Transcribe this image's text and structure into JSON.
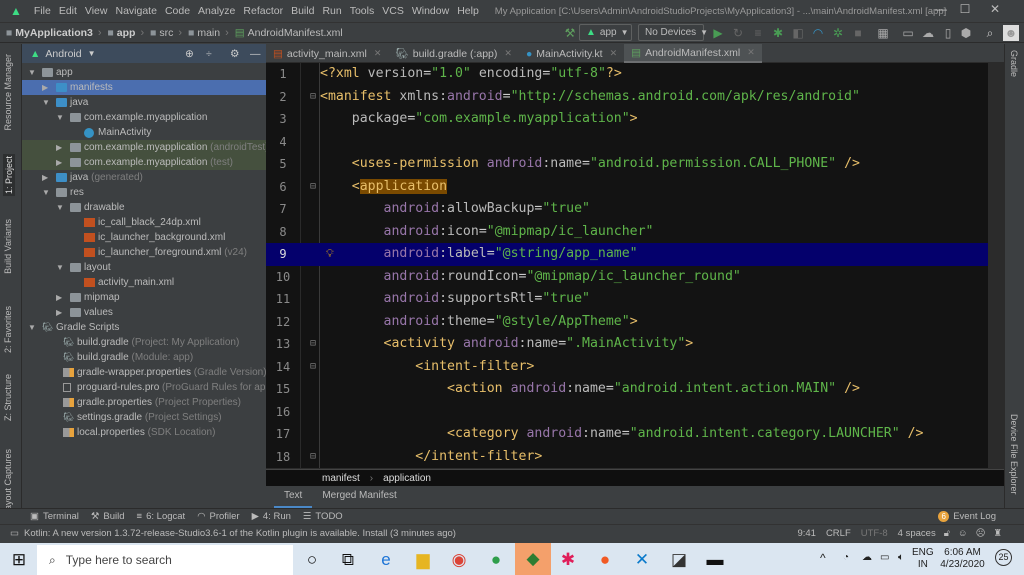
{
  "menu": [
    "File",
    "Edit",
    "View",
    "Navigate",
    "Code",
    "Analyze",
    "Refactor",
    "Build",
    "Run",
    "Tools",
    "VCS",
    "Window",
    "Help"
  ],
  "window_title": "My Application [C:\\Users\\Admin\\AndroidStudioProjects\\MyApplication3] - ...\\main\\AndroidManifest.xml [app]",
  "breadcrumb": [
    "MyApplication3",
    "app",
    "src",
    "main",
    "AndroidManifest.xml"
  ],
  "toolbar": {
    "run_config": "app",
    "device": "No Devices"
  },
  "project": {
    "view": "Android",
    "tree": [
      {
        "level": 0,
        "arrow": "down",
        "icon": "module",
        "label": "app",
        "hint": "",
        "state": ""
      },
      {
        "level": 1,
        "arrow": "right",
        "icon": "folder-blue",
        "label": "manifests",
        "hint": "",
        "state": "sel"
      },
      {
        "level": 1,
        "arrow": "down",
        "icon": "folder-blue",
        "label": "java",
        "hint": "",
        "state": ""
      },
      {
        "level": 2,
        "arrow": "down",
        "icon": "package",
        "label": "com.example.myapplication",
        "hint": "",
        "state": ""
      },
      {
        "level": 3,
        "arrow": "",
        "icon": "kotlin-class",
        "label": "MainActivity",
        "hint": "",
        "state": ""
      },
      {
        "level": 2,
        "arrow": "right",
        "icon": "package",
        "label": "com.example.myapplication",
        "hint": "(androidTest)",
        "state": "test"
      },
      {
        "level": 2,
        "arrow": "right",
        "icon": "package",
        "label": "com.example.myapplication",
        "hint": "(test)",
        "state": "test"
      },
      {
        "level": 1,
        "arrow": "right",
        "icon": "folder-blue",
        "label": "java",
        "hint": "(generated)",
        "state": ""
      },
      {
        "level": 1,
        "arrow": "down",
        "icon": "folder",
        "label": "res",
        "hint": "",
        "state": ""
      },
      {
        "level": 2,
        "arrow": "down",
        "icon": "package",
        "label": "drawable",
        "hint": "",
        "state": ""
      },
      {
        "level": 3,
        "arrow": "",
        "icon": "xml",
        "label": "ic_call_black_24dp.xml",
        "hint": "",
        "state": ""
      },
      {
        "level": 3,
        "arrow": "",
        "icon": "xml",
        "label": "ic_launcher_background.xml",
        "hint": "",
        "state": ""
      },
      {
        "level": 3,
        "arrow": "",
        "icon": "xml",
        "label": "ic_launcher_foreground.xml",
        "hint": "(v24)",
        "state": ""
      },
      {
        "level": 2,
        "arrow": "down",
        "icon": "package",
        "label": "layout",
        "hint": "",
        "state": ""
      },
      {
        "level": 3,
        "arrow": "",
        "icon": "xml",
        "label": "activity_main.xml",
        "hint": "",
        "state": ""
      },
      {
        "level": 2,
        "arrow": "right",
        "icon": "package",
        "label": "mipmap",
        "hint": "",
        "state": ""
      },
      {
        "level": 2,
        "arrow": "right",
        "icon": "package",
        "label": "values",
        "hint": "",
        "state": ""
      },
      {
        "level": 0,
        "arrow": "down",
        "icon": "gradle",
        "label": "Gradle Scripts",
        "hint": "",
        "state": ""
      },
      {
        "level": 1.5,
        "arrow": "",
        "icon": "gradle",
        "label": "build.gradle",
        "hint": "(Project: My Application)",
        "state": ""
      },
      {
        "level": 1.5,
        "arrow": "",
        "icon": "gradle",
        "label": "build.gradle",
        "hint": "(Module: app)",
        "state": ""
      },
      {
        "level": 1.5,
        "arrow": "",
        "icon": "props",
        "label": "gradle-wrapper.properties",
        "hint": "(Gradle Version)",
        "state": ""
      },
      {
        "level": 1.5,
        "arrow": "",
        "icon": "file",
        "label": "proguard-rules.pro",
        "hint": "(ProGuard Rules for app)",
        "state": ""
      },
      {
        "level": 1.5,
        "arrow": "",
        "icon": "props",
        "label": "gradle.properties",
        "hint": "(Project Properties)",
        "state": ""
      },
      {
        "level": 1.5,
        "arrow": "",
        "icon": "gradle",
        "label": "settings.gradle",
        "hint": "(Project Settings)",
        "state": ""
      },
      {
        "level": 1.5,
        "arrow": "",
        "icon": "props",
        "label": "local.properties",
        "hint": "(SDK Location)",
        "state": ""
      }
    ]
  },
  "left_stripe": [
    "Resource Manager",
    "1: Project",
    "Build Variants",
    "2: Favorites",
    "Z: Structure",
    "Layout Captures"
  ],
  "right_stripe": [
    "Gradle",
    "Device File Explorer"
  ],
  "tabs": [
    {
      "label": "activity_main.xml",
      "active": false
    },
    {
      "label": "build.gradle (:app)",
      "active": false
    },
    {
      "label": "MainActivity.kt",
      "active": false
    },
    {
      "label": "AndroidManifest.xml",
      "active": true
    }
  ],
  "code": [
    [
      [
        "pi",
        "<?xml "
      ],
      [
        "attr",
        "version"
      ],
      [
        "plain",
        "="
      ],
      [
        "val",
        "\"1.0\""
      ],
      [
        "plain",
        " "
      ],
      [
        "attr",
        "encoding"
      ],
      [
        "plain",
        "="
      ],
      [
        "val",
        "\"utf-8\""
      ],
      [
        "pi",
        "?>"
      ]
    ],
    [
      [
        "tag",
        "<manifest "
      ],
      [
        "attr",
        "xmlns:"
      ],
      [
        "ns",
        "android"
      ],
      [
        "plain",
        "="
      ],
      [
        "val",
        "\"http://schemas.android.com/apk/res/android\""
      ]
    ],
    [
      [
        "plain",
        "    "
      ],
      [
        "attr",
        "package"
      ],
      [
        "plain",
        "="
      ],
      [
        "val",
        "\"com.example.myapplication\""
      ],
      [
        "tag",
        ">"
      ]
    ],
    [],
    [
      [
        "plain",
        "    "
      ],
      [
        "tag",
        "<uses-permission "
      ],
      [
        "ns",
        "android"
      ],
      [
        "attr",
        ":name"
      ],
      [
        "plain",
        "="
      ],
      [
        "val",
        "\"android.permission.CALL_PHONE\""
      ],
      [
        "tag",
        " />"
      ]
    ],
    [
      [
        "plain",
        "    "
      ],
      [
        "tag",
        "<"
      ],
      [
        "hltag",
        "application"
      ]
    ],
    [
      [
        "plain",
        "        "
      ],
      [
        "ns",
        "android"
      ],
      [
        "attr",
        ":allowBackup"
      ],
      [
        "plain",
        "="
      ],
      [
        "val",
        "\"true\""
      ]
    ],
    [
      [
        "plain",
        "        "
      ],
      [
        "ns",
        "android"
      ],
      [
        "attr",
        ":icon"
      ],
      [
        "plain",
        "="
      ],
      [
        "val",
        "\"@mipmap/ic_launcher\""
      ]
    ],
    [
      [
        "plain",
        "        "
      ],
      [
        "ns",
        "android"
      ],
      [
        "attr",
        ":label"
      ],
      [
        "plain",
        "="
      ],
      [
        "val",
        "\"@string/app_name\""
      ]
    ],
    [
      [
        "plain",
        "        "
      ],
      [
        "ns",
        "android"
      ],
      [
        "attr",
        ":roundIcon"
      ],
      [
        "plain",
        "="
      ],
      [
        "val",
        "\"@mipmap/ic_launcher_round\""
      ]
    ],
    [
      [
        "plain",
        "        "
      ],
      [
        "ns",
        "android"
      ],
      [
        "attr",
        ":supportsRtl"
      ],
      [
        "plain",
        "="
      ],
      [
        "val",
        "\"true\""
      ]
    ],
    [
      [
        "plain",
        "        "
      ],
      [
        "ns",
        "android"
      ],
      [
        "attr",
        ":theme"
      ],
      [
        "plain",
        "="
      ],
      [
        "val",
        "\"@style/AppTheme\""
      ],
      [
        "tag",
        ">"
      ]
    ],
    [
      [
        "plain",
        "        "
      ],
      [
        "tag",
        "<activity "
      ],
      [
        "ns",
        "android"
      ],
      [
        "attr",
        ":name"
      ],
      [
        "plain",
        "="
      ],
      [
        "val",
        "\".MainActivity\""
      ],
      [
        "tag",
        ">"
      ]
    ],
    [
      [
        "plain",
        "            "
      ],
      [
        "tag",
        "<intent-filter>"
      ]
    ],
    [
      [
        "plain",
        "                "
      ],
      [
        "tag",
        "<action "
      ],
      [
        "ns",
        "android"
      ],
      [
        "attr",
        ":name"
      ],
      [
        "plain",
        "="
      ],
      [
        "val",
        "\"android.intent.action.MAIN\""
      ],
      [
        "tag",
        " />"
      ]
    ],
    [],
    [
      [
        "plain",
        "                "
      ],
      [
        "tag",
        "<category "
      ],
      [
        "ns",
        "android"
      ],
      [
        "attr",
        ":name"
      ],
      [
        "plain",
        "="
      ],
      [
        "val",
        "\"android.intent.category.LAUNCHER\""
      ],
      [
        "tag",
        " />"
      ]
    ],
    [
      [
        "plain",
        "            "
      ],
      [
        "tag",
        "</intent-filter>"
      ]
    ]
  ],
  "highlighted_line": 9,
  "editor_breadcrumb": [
    "manifest",
    "application"
  ],
  "editor_bottom_tabs": [
    "Text",
    "Merged Manifest"
  ],
  "tool_windows": [
    "Terminal",
    "Build",
    "6: Logcat",
    "Profiler",
    "4: Run",
    "TODO"
  ],
  "event_log": {
    "count": "6",
    "label": "Event Log"
  },
  "status": {
    "message": "Kotlin: A new version 1.3.72-release-Studio3.6-1 of the Kotlin plugin is available. Install (3 minutes ago)",
    "position": "9:41",
    "line_sep": "CRLF",
    "encoding": "UTF-8",
    "indent": "4 spaces"
  },
  "taskbar": {
    "search_placeholder": "Type here to search",
    "lang1": "ENG",
    "lang2": "IN",
    "time": "6:06 AM",
    "date": "4/23/2020",
    "notifications": "25"
  },
  "colors": {
    "accent": "#4b6eaf",
    "highlight_line": "#04006c",
    "value": "#5fb54a",
    "tag": "#e8bf6a"
  }
}
